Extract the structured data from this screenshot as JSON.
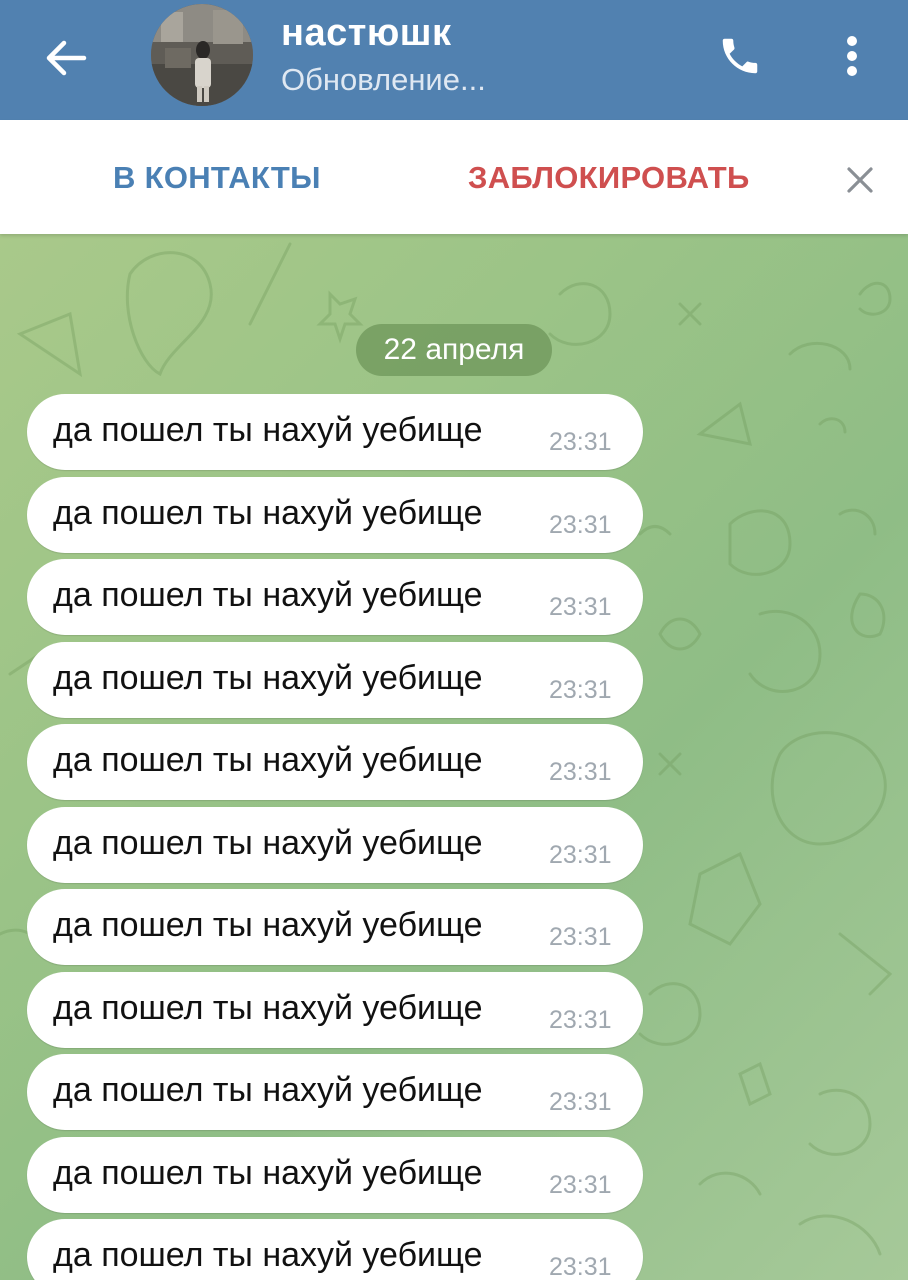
{
  "header": {
    "title": "настюшк",
    "subtitle": "Обновление...",
    "back_icon": "arrow-left-icon",
    "call_icon": "phone-icon",
    "menu_icon": "more-vertical-icon",
    "background_color": "#5181b0"
  },
  "action_bar": {
    "add_contact_label": "В КОНТАКТЫ",
    "block_label": "ЗАБЛОКИРОВАТЬ",
    "close_icon": "close-icon",
    "add_contact_color": "#4a80b4",
    "block_color": "#cf4f4f"
  },
  "chat": {
    "date_label": "22 апреля",
    "messages": [
      {
        "text": "да пошел ты нахуй уебище",
        "time": "23:31"
      },
      {
        "text": "да пошел ты нахуй уебище",
        "time": "23:31"
      },
      {
        "text": "да пошел ты нахуй уебище",
        "time": "23:31"
      },
      {
        "text": "да пошел ты нахуй уебище",
        "time": "23:31"
      },
      {
        "text": "да пошел ты нахуй уебище",
        "time": "23:31"
      },
      {
        "text": "да пошел ты нахуй уебище",
        "time": "23:31"
      },
      {
        "text": "да пошел ты нахуй уебище",
        "time": "23:31"
      },
      {
        "text": "да пошел ты нахуй уебище",
        "time": "23:31"
      },
      {
        "text": "да пошел ты нахуй уебище",
        "time": "23:31"
      },
      {
        "text": "да пошел ты нахуй уебище",
        "time": "23:31"
      },
      {
        "text": "да пошел ты нахуй уебище",
        "time": "23:31"
      }
    ]
  }
}
